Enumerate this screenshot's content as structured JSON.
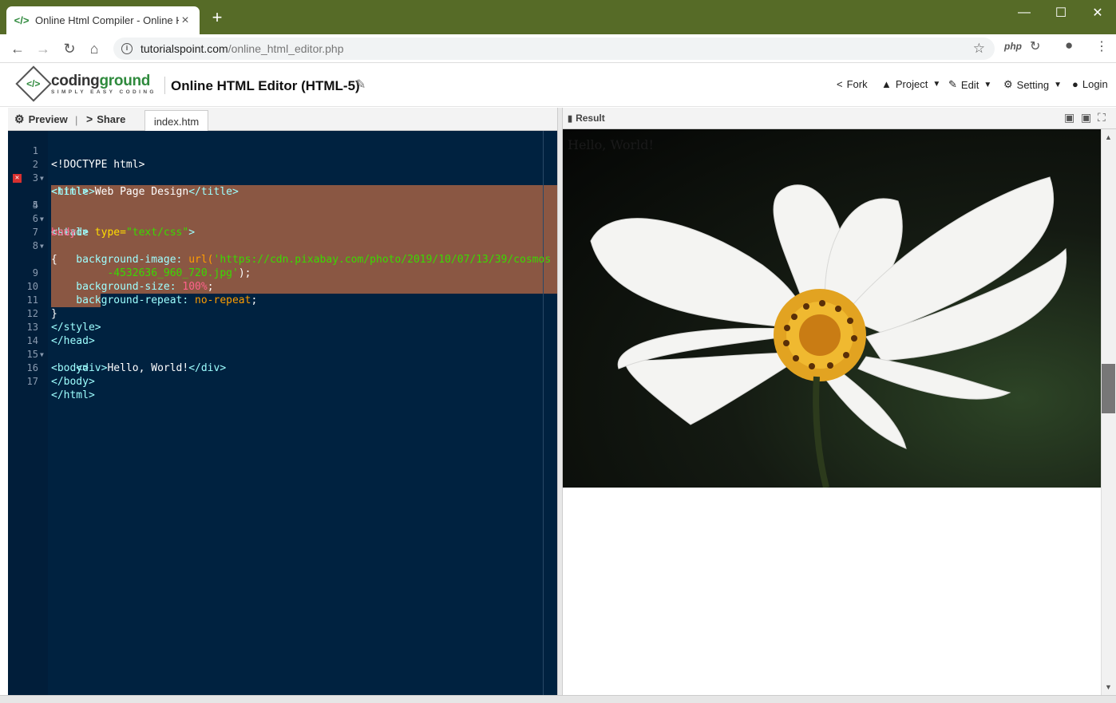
{
  "browser": {
    "tab_title": "Online Html Compiler - Online H",
    "tab_close": "×",
    "new_tab": "+",
    "url_host": "tutorialspoint.com",
    "url_path": "/online_html_editor.php",
    "ext_php": "php"
  },
  "header": {
    "logo_name_a": "coding",
    "logo_name_b": "ground",
    "logo_tagline": "SIMPLY EASY CODING",
    "page_title": "Online HTML Editor (HTML-5)",
    "menu": {
      "fork": "Fork",
      "project": "Project",
      "edit": "Edit",
      "setting": "Setting",
      "login": "Login"
    }
  },
  "left_tabs": {
    "preview": "Preview",
    "share": "Share",
    "file": "index.htm"
  },
  "editor": {
    "line_numbers": [
      "1",
      "2",
      "3",
      "4",
      "5",
      "6",
      "7",
      "8",
      "",
      "9",
      "10",
      "11",
      "12",
      "13",
      "14",
      "15",
      "16",
      "17"
    ],
    "error_line": 4,
    "code": {
      "l1": "<!DOCTYPE html>",
      "l2": "<html>",
      "l3_open": "<title>",
      "l3_text": "Web Page Design",
      "l3_close": "</title>",
      "l4": "<head>",
      "l5_tag": "<style ",
      "l5_attr": "type=",
      "l5_str": "\"text/css\"",
      "l5_end": ">",
      "l6": "body",
      "l7": "{",
      "l8_prop": "    background-image: ",
      "l8_fn": "url(",
      "l8_str1": "'https://cdn.pixabay.com/photo/2019/10/07/13/39/cosmos",
      "l8b_str2": "         -4532636_960_720.jpg'",
      "l8b_end": ");",
      "l9_prop": "    background-size: ",
      "l9_val": "100%",
      "l9_end": ";",
      "l10_prop": "    background-repeat: ",
      "l10_val": "no-repeat",
      "l10_end": ";",
      "l11": "}",
      "l12": "</style>",
      "l13": "</head>",
      "l14": "<body>",
      "l15_open": "    <div>",
      "l15_text": "Hello, World!",
      "l15_close": "</div>",
      "l16": "</body>",
      "l17": "</html>"
    }
  },
  "result": {
    "label": "Result",
    "hello_text": "Hello, World!"
  }
}
